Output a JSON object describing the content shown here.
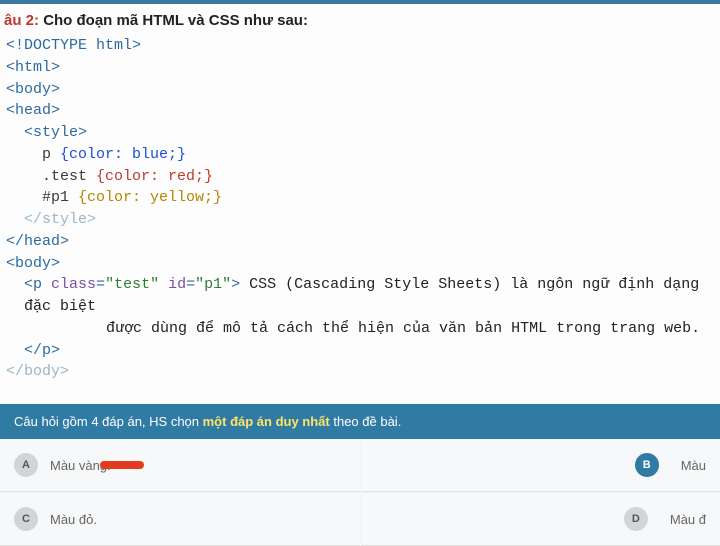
{
  "question": {
    "num_label": "âu 2:",
    "prompt": "Cho đoạn mã HTML và CSS như sau:"
  },
  "code": {
    "l1": "<!DOCTYPE html>",
    "l2": "<html>",
    "l3": "<body>",
    "l4": "<head>",
    "l5": "<style>",
    "l6_sel": "p",
    "l6_rule": "{color: blue;}",
    "l7_sel": ".test",
    "l7_rule": "{color: red;}",
    "l8_sel": "#p1",
    "l8_rule": "{color: yellow;}",
    "l9": "</style>",
    "l10": "</head>",
    "l11": "<body>",
    "l12_open": "<p",
    "l12_a1n": "class",
    "l12_a1v": "\"test\"",
    "l12_a2n": "id",
    "l12_a2v": "\"p1\"",
    "l12_close": ">",
    "l12_text1": "CSS (Cascading Style Sheets) là ngôn ngữ định dạng đặc biệt",
    "l13_text2": "được dùng để mô tả cách thể hiện của văn bản HTML trong trang web.",
    "l14": "</p>",
    "l15": "</body>"
  },
  "instruction": {
    "pre": "Câu hỏi gồm 4 đáp án, HS chọn ",
    "highlight": "một đáp án duy nhất",
    "post": " theo đề bài."
  },
  "options": {
    "a": {
      "letter": "A",
      "text": "Màu vàng."
    },
    "b": {
      "letter": "B",
      "text": "Màu"
    },
    "c": {
      "letter": "C",
      "text": "Màu đỏ."
    },
    "d": {
      "letter": "D",
      "text": "Màu đ"
    }
  }
}
